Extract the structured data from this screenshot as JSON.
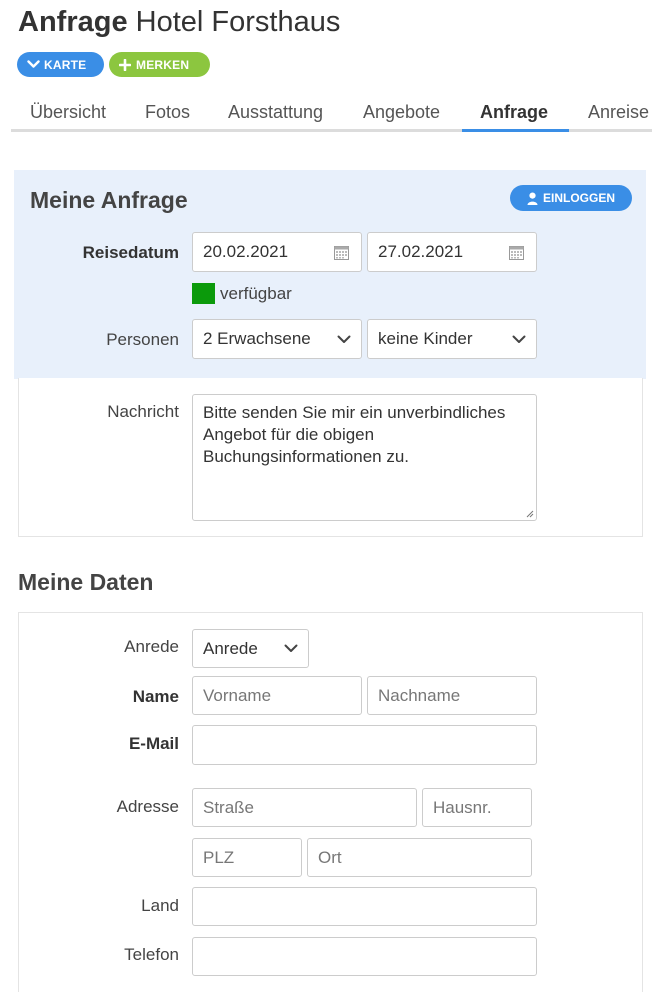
{
  "header": {
    "title_bold": "Anfrage",
    "title_rest": "Hotel Forsthaus",
    "karte_label": "KARTE",
    "merken_label": "MERKEN"
  },
  "tabs": [
    {
      "label": "Übersicht",
      "active": false
    },
    {
      "label": "Fotos",
      "active": false
    },
    {
      "label": "Ausstattung",
      "active": false
    },
    {
      "label": "Angebote",
      "active": false
    },
    {
      "label": "Anfrage",
      "active": true
    },
    {
      "label": "Anreise",
      "active": false
    }
  ],
  "anfrage": {
    "title": "Meine Anfrage",
    "login_label": "EINLOGGEN",
    "reisedatum_label": "Reisedatum",
    "date_from": "20.02.2021",
    "date_to": "27.02.2021",
    "availability": "verfügbar",
    "availability_color": "#0b9a0b",
    "personen_label": "Personen",
    "adults_value": "2 Erwachsene",
    "children_value": "keine Kinder",
    "nachricht_label": "Nachricht",
    "message_lines": [
      "Bitte senden Sie mir ein unverbindliches",
      "Angebot für die obigen",
      "Buchungsinformationen zu."
    ]
  },
  "daten": {
    "title": "Meine Daten",
    "anrede_label": "Anrede",
    "anrede_value": "Anrede",
    "name_label": "Name",
    "vorname_placeholder": "Vorname",
    "nachname_placeholder": "Nachname",
    "email_label": "E-Mail",
    "adresse_label": "Adresse",
    "strasse_placeholder": "Straße",
    "hausnr_placeholder": "Hausnr.",
    "plz_placeholder": "PLZ",
    "ort_placeholder": "Ort",
    "land_label": "Land",
    "telefon_label": "Telefon"
  },
  "colors": {
    "accent": "#3a8ee6",
    "merken": "#8cc63f",
    "panel": "#e8f0fb"
  }
}
